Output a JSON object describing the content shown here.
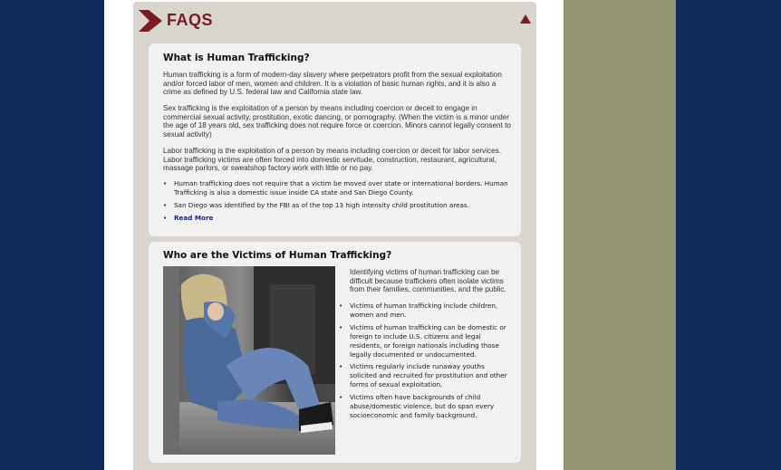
{
  "faq": {
    "title": "FAQS",
    "icons": {
      "logo": "chevron-right-icon",
      "collapse": "triangle-up-icon"
    },
    "colors": {
      "accent": "#7a1c1f",
      "page_bg": "#0f2b5a",
      "olive": "#939571",
      "panel": "#d8d5cf",
      "card": "#f1f1f1",
      "link": "#1a1f8a"
    }
  },
  "trafficking": {
    "title": "What is Human Trafficking?",
    "paragraphs": [
      "Human trafficking is a form of modern-day slavery where perpetrators profit from the sexual exploitation and/or forced labor of men, women and children. It is a violation of basic human rights, and it is also a crime as defined by U.S. federal law and California state law.",
      "Sex trafficking is the exploitation of a person by means including coercion or deceit to engage in commercial sexual activity, prostitution, exotic dancing, or pornography. (When the victim is a minor under the age of 18 years old, sex trafficking does not require force or coercion. Minors cannot legally consent to sexual activity)",
      "Labor trafficking is the exploitation of a person by means including coercion or deceit for labor services. Labor trafficking victims are often forced into domestic servitude, construction, restaurant, agricultural, massage parlors, or sweatshop factory work with little or no pay."
    ],
    "bullets": [
      "Human trafficking does not require that a victim be moved over state or international borders. Human Trafficking is also a domestic issue inside CA state and San Diego County.",
      "San Diego was identified by the FBI as of the top 13 high intensity child prostitution areas."
    ],
    "read_more": "Read More"
  },
  "victims": {
    "title": "Who are the Victims of Human Trafficking?",
    "intro": "Identifying victims of human trafficking can be difficult because traffickers often isolate victims from their families, communities, and the public.",
    "bullets": [
      "Victims of human trafficking include children, women and men.",
      "Victims of human trafficking can be domestic or foreign to include U.S. citizens and legal residents, or foreign nationals including those legally documented or undocumented.",
      "Victims regularly include runaway youths solicited and recruited for prostitution and other forms of sexual exploitation.",
      "Victims often have backgrounds of child abuse/domestic violence, but do span every socioeconomic and family background."
    ]
  }
}
